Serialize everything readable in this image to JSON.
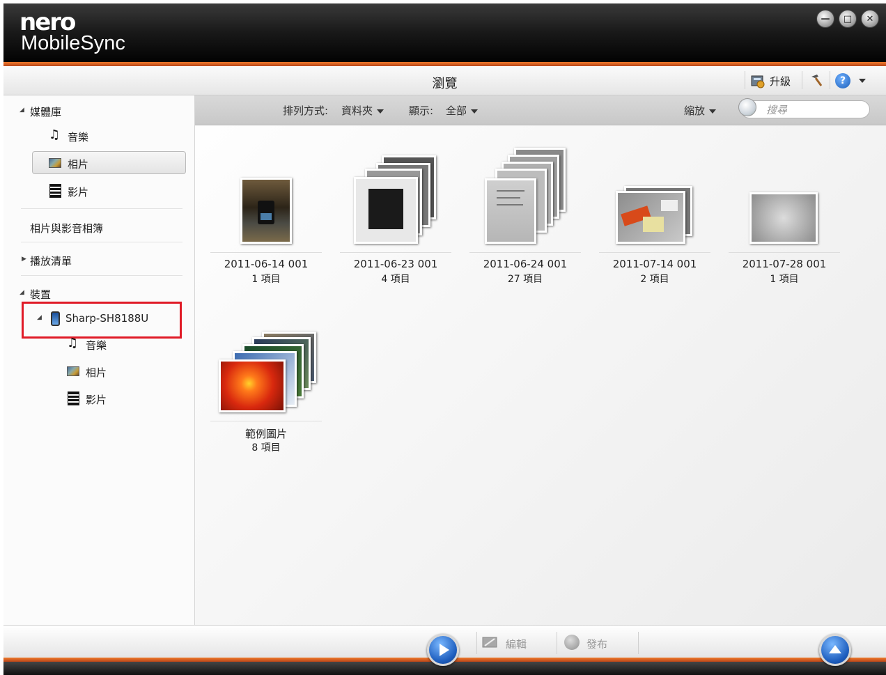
{
  "app": {
    "brand": "nero",
    "name": "MobileSync"
  },
  "window_controls": {
    "minimize_icon": "minimize-icon",
    "maximize_icon": "maximize-icon",
    "close_icon": "close-icon"
  },
  "header": {
    "title": "瀏覽",
    "upgrade_label": "升級",
    "tools_icon": "hammer-icon",
    "help_icon": "help-icon"
  },
  "sidebar": {
    "library_label": "媒體庫",
    "library_items": [
      {
        "label": "音樂",
        "icon": "music-icon"
      },
      {
        "label": "相片",
        "icon": "photo-icon",
        "selected": true
      },
      {
        "label": "影片",
        "icon": "film-icon"
      }
    ],
    "photo_video_album": "相片與影音相簿",
    "playlist_label": "播放清單",
    "devices_label": "裝置",
    "device_name": "Sharp-SH8188U",
    "device_items": [
      {
        "label": "音樂",
        "icon": "music-icon"
      },
      {
        "label": "相片",
        "icon": "photo-icon"
      },
      {
        "label": "影片",
        "icon": "film-icon"
      }
    ]
  },
  "toolbar": {
    "sort_label": "排列方式:",
    "sort_value": "資料夾",
    "display_label": "顯示:",
    "display_value": "全部",
    "zoom_label": "縮放",
    "search_placeholder": "搜尋"
  },
  "albums": [
    {
      "name": "2011-06-14 001",
      "count": "1 項目"
    },
    {
      "name": "2011-06-23 001",
      "count": "4 項目"
    },
    {
      "name": "2011-06-24 001",
      "count": "27 項目"
    },
    {
      "name": "2011-07-14 001",
      "count": "2 項目"
    },
    {
      "name": "2011-07-28 001",
      "count": "1 項目"
    },
    {
      "name": "範例圖片",
      "count": "8 項目"
    }
  ],
  "bottom": {
    "edit_label": "編輯",
    "publish_label": "發布"
  },
  "colors": {
    "accent": "#e8742a",
    "selection_border": "#e01a26",
    "button_blue": "#1f5fbf"
  }
}
